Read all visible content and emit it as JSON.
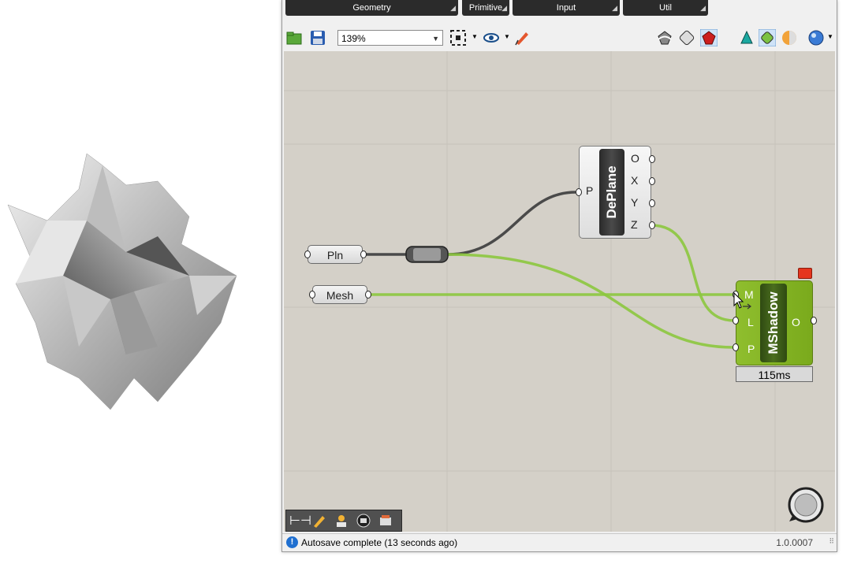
{
  "ribbon": {
    "tabs": [
      {
        "label": "Geometry"
      },
      {
        "label": "Primitive"
      },
      {
        "label": "Input"
      },
      {
        "label": "Util"
      }
    ]
  },
  "toolbar": {
    "zoom_value": "139%"
  },
  "canvas": {
    "param_pln": "Pln",
    "param_mesh": "Mesh",
    "deplane": {
      "title": "DePlane",
      "input_p": "P",
      "outputs": [
        "O",
        "X",
        "Y",
        "Z"
      ]
    },
    "mshadow": {
      "title": "MShadow",
      "inputs": [
        "M",
        "L",
        "P"
      ],
      "output_o": "O",
      "timer": "115ms"
    }
  },
  "status": {
    "message": "Autosave complete (13 seconds ago)",
    "version": "1.0.0007"
  },
  "colors": {
    "canvas_bg": "#d4d0c8",
    "wire_selected": "#8cc63e",
    "component_green": "#8fbe2e"
  }
}
